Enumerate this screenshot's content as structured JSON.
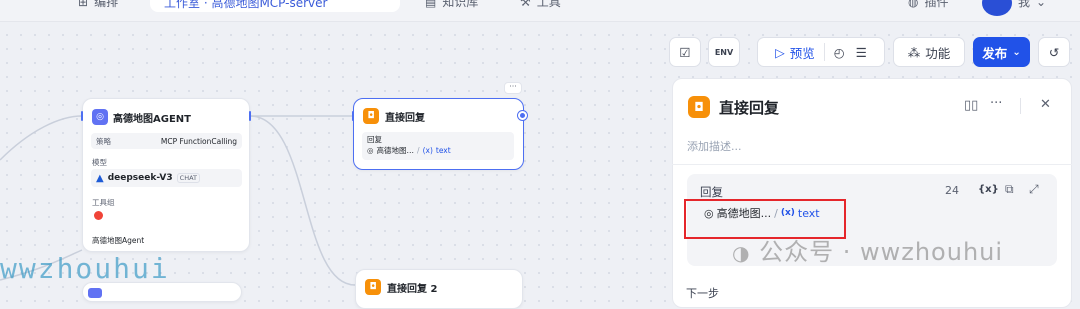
{
  "topbar": {
    "items": [
      "编排",
      "工作室 · 高德地图MCP-server",
      "知识库",
      "工具",
      "插件",
      "我"
    ]
  },
  "toolbar": {
    "preview_label": "预览",
    "features_label": "功能",
    "publish_label": "发布",
    "env_label": "ENV"
  },
  "node_agent": {
    "title": "高德地图AGENT",
    "strategy_label": "策略",
    "strategy_value": "MCP FunctionCalling",
    "model_label": "模型",
    "model_name": "deepseek-V3",
    "model_badge": "CHAT",
    "tools_label": "工具组",
    "footer": "高德地图Agent"
  },
  "node_reply": {
    "title": "直接回复",
    "reply_label": "回复",
    "var_source": "高德地图…",
    "var_name": "text",
    "var_prefix": "(x)"
  },
  "node_reply2": {
    "title": "直接回复 2"
  },
  "panel": {
    "title": "直接回复",
    "desc_placeholder": "添加描述...",
    "reply_label": "回复",
    "char_count": "24",
    "var_source": "高德地图...",
    "var_name": "text",
    "var_prefix": "(x)",
    "next_label": "下一步"
  },
  "watermark": {
    "text": "公众号 · wwzhouhui",
    "left_text": "wwzhouhui"
  },
  "colors": {
    "accent": "#4d6ff2",
    "reply_icon": "#f79009",
    "highlight": "#e5262b",
    "publish": "#2152e8"
  }
}
